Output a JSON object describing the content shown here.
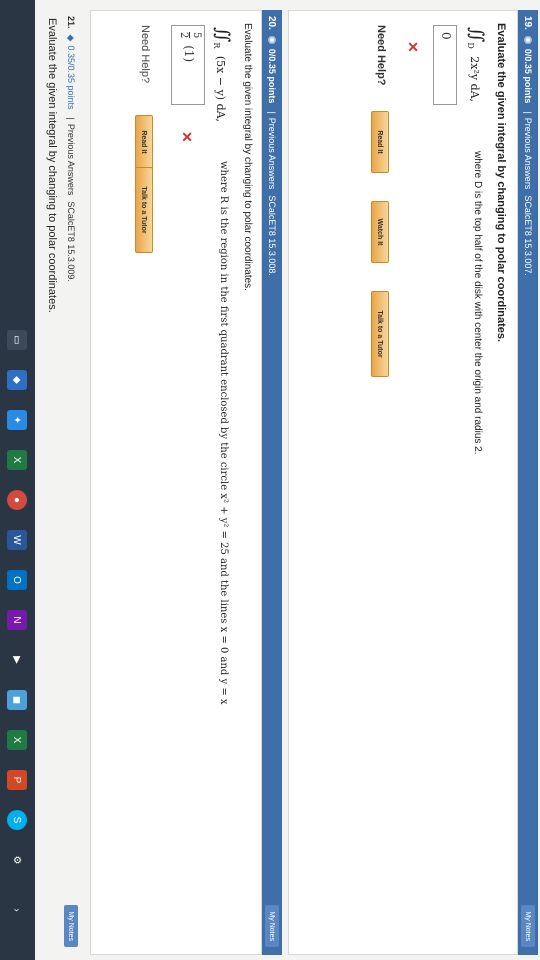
{
  "q19": {
    "num": "19.",
    "points": "0/0.35 points",
    "sep": "|",
    "prev": "Previous Answers",
    "code": "SCalcET8 15.3.007.",
    "prompt": "Evaluate the given integral by changing to polar coordinates.",
    "integral": "∬",
    "subscript": "D",
    "integrand": "2x²y dA,",
    "condition": "where D is the top half of the disk with center the origin and radius 2.",
    "answer": "0",
    "need_help": "Need Help?",
    "btn_read": "Read It",
    "btn_watch": "Watch It",
    "btn_tutor": "Talk to a Tutor",
    "notes": "My Notes"
  },
  "q20": {
    "num": "20.",
    "points": "0/0.35 points",
    "sep": "|",
    "prev": "Previous Answers",
    "code": "SCalcET8 15.3.008.",
    "prompt": "Evaluate the given integral by changing to polar coordinates.",
    "integral": "∬",
    "subscript": "R",
    "integrand": "(5x − y) dA,",
    "condition": "where R is the region in the first quadrant enclosed by the circle  x² + y² = 25  and the lines  x = 0  and  y = x",
    "answer_num": "5",
    "answer_den": "2",
    "answer_rest": "(1)",
    "need_help": "Need Help?",
    "btn_read": "Read It",
    "btn_tutor": "Talk to a Tutor",
    "notes": "My Notes"
  },
  "q21": {
    "num": "21.",
    "points": "0.35/0.35 points",
    "sep": "|",
    "prev": "Previous Answers",
    "code": "SCalcET8 15.3.009.",
    "prompt": "Evaluate the given integral by changing to polar coordinates.",
    "notes": "My Notes"
  },
  "xmark": "✕"
}
